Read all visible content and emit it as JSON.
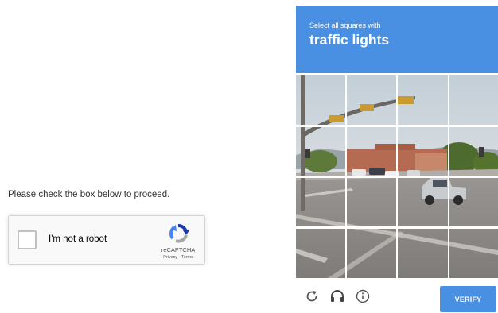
{
  "page": {
    "instruction": "Please check the box below to proceed."
  },
  "recaptcha_widget": {
    "checkbox_label": "I'm not a robot",
    "checked": false,
    "brand": "reCAPTCHA",
    "privacy_link": "Privacy",
    "separator": " - ",
    "terms_link": "Terms",
    "logo_icon": "recaptcha-logo-icon"
  },
  "challenge": {
    "prompt_small": "Select all squares with",
    "prompt_target": "traffic lights",
    "grid": {
      "rows": 4,
      "cols": 4
    },
    "verify_label": "VERIFY",
    "icons": [
      "reload-icon",
      "headphones-icon",
      "info-icon"
    ]
  },
  "colors": {
    "accent_blue": "#4a90e2",
    "checkbox_border": "#c1c1c1",
    "widget_bg": "#f9f9f9"
  }
}
